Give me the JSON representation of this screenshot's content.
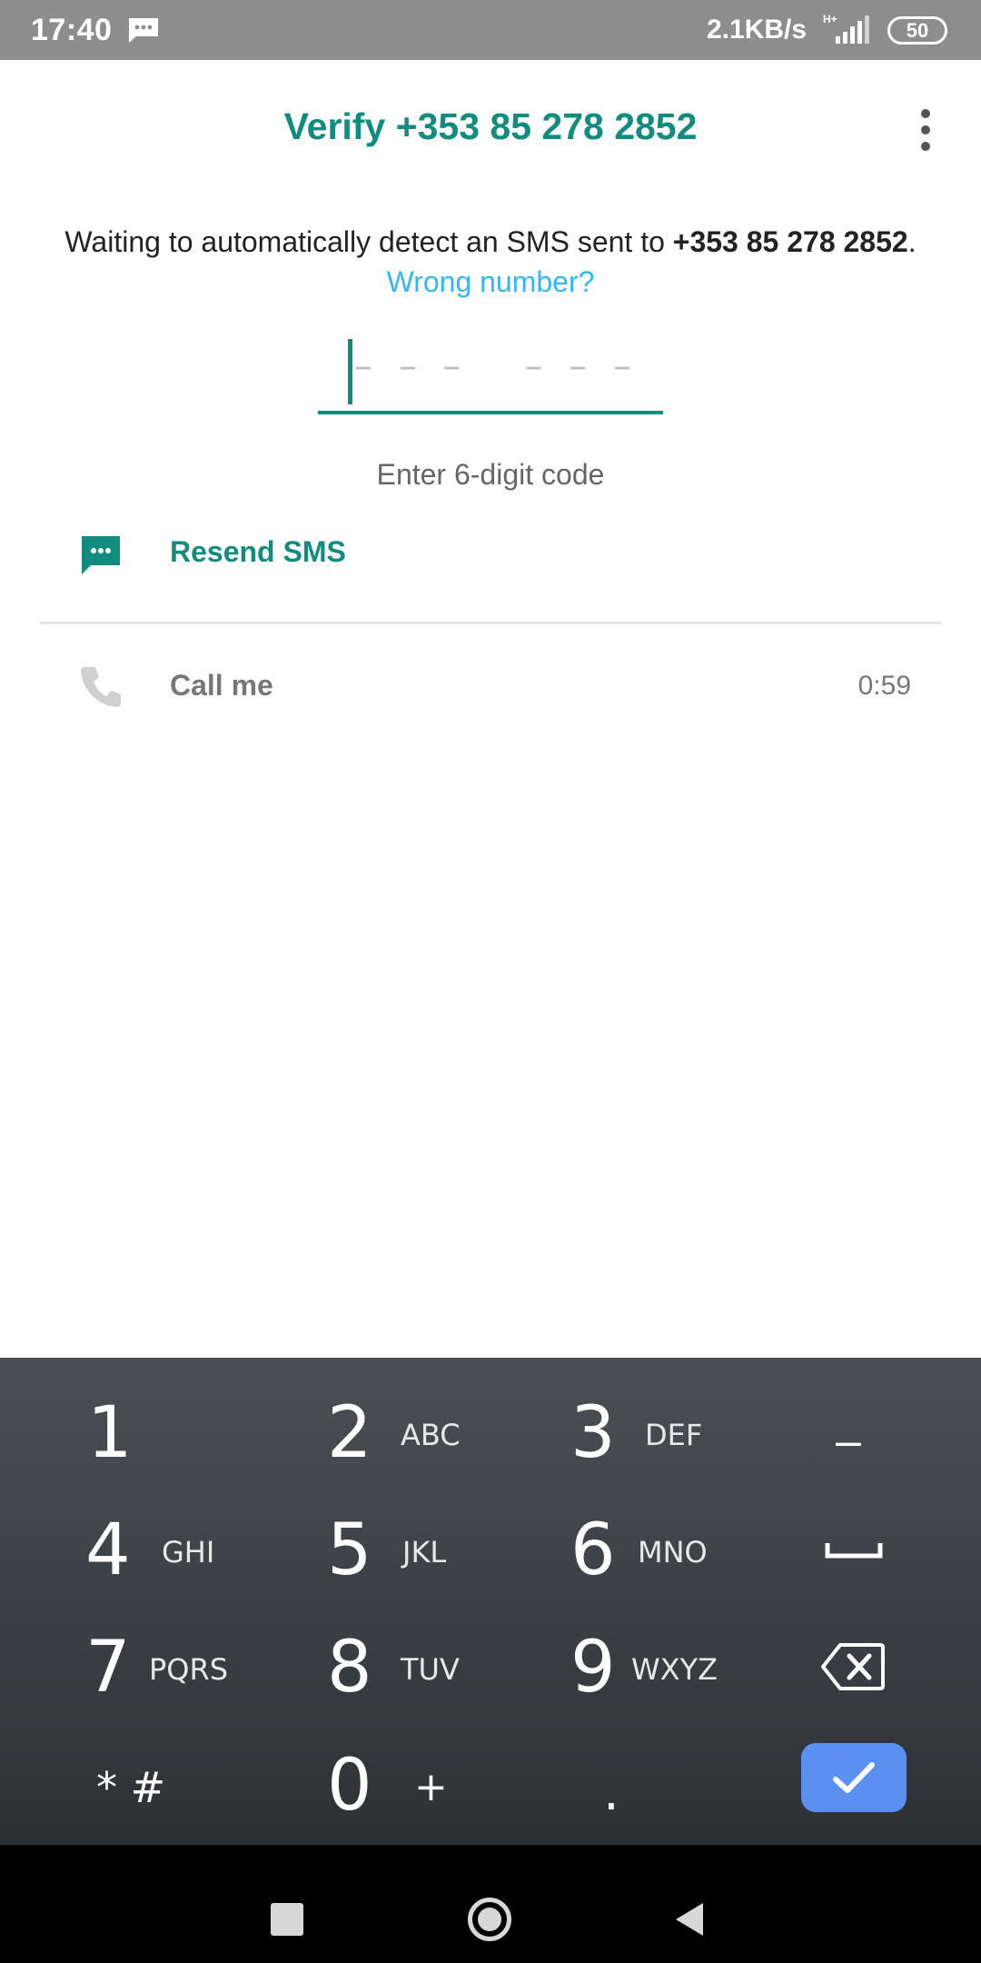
{
  "status_bar": {
    "time": "17:40",
    "network_speed": "2.1KB/s",
    "network_type": "H+",
    "battery": "50",
    "message_icon": "sms-notification-icon"
  },
  "header": {
    "title": "Verify +353 85 278 2852",
    "menu_icon": "more-vert-icon"
  },
  "description": {
    "prefix": "Waiting to automatically detect an SMS sent to ",
    "phone": "+353 85 278 2852",
    "suffix": "."
  },
  "wrong_number_link": "Wrong number?",
  "code_input": {
    "value": "",
    "placeholder": "– – –   – – –",
    "hint": "Enter 6-digit code"
  },
  "options": {
    "resend": {
      "label": "Resend SMS",
      "icon": "message-icon"
    },
    "call": {
      "label": "Call me",
      "icon": "phone-icon",
      "timer": "0:59"
    }
  },
  "keypad": {
    "keys": [
      {
        "digit": "1",
        "letters": ""
      },
      {
        "digit": "2",
        "letters": "ABC"
      },
      {
        "digit": "3",
        "letters": "DEF"
      },
      {
        "digit": "4",
        "letters": "GHI"
      },
      {
        "digit": "5",
        "letters": "JKL"
      },
      {
        "digit": "6",
        "letters": "MNO"
      },
      {
        "digit": "7",
        "letters": "PQRS"
      },
      {
        "digit": "8",
        "letters": "TUV"
      },
      {
        "digit": "9",
        "letters": "WXYZ"
      },
      {
        "digit": "0",
        "letters": "+"
      }
    ],
    "minus": "–",
    "star_hash": "* #",
    "period": ".",
    "space_icon": "space-bar-icon",
    "backspace_icon": "backspace-icon",
    "confirm_icon": "checkmark-icon",
    "accent_color": "#5b8ff0"
  },
  "navbar": {
    "recents_icon": "square-icon",
    "home_icon": "circle-icon",
    "back_icon": "triangle-back-icon"
  },
  "colors": {
    "primary": "#128c7e",
    "link": "#34b7f1"
  }
}
